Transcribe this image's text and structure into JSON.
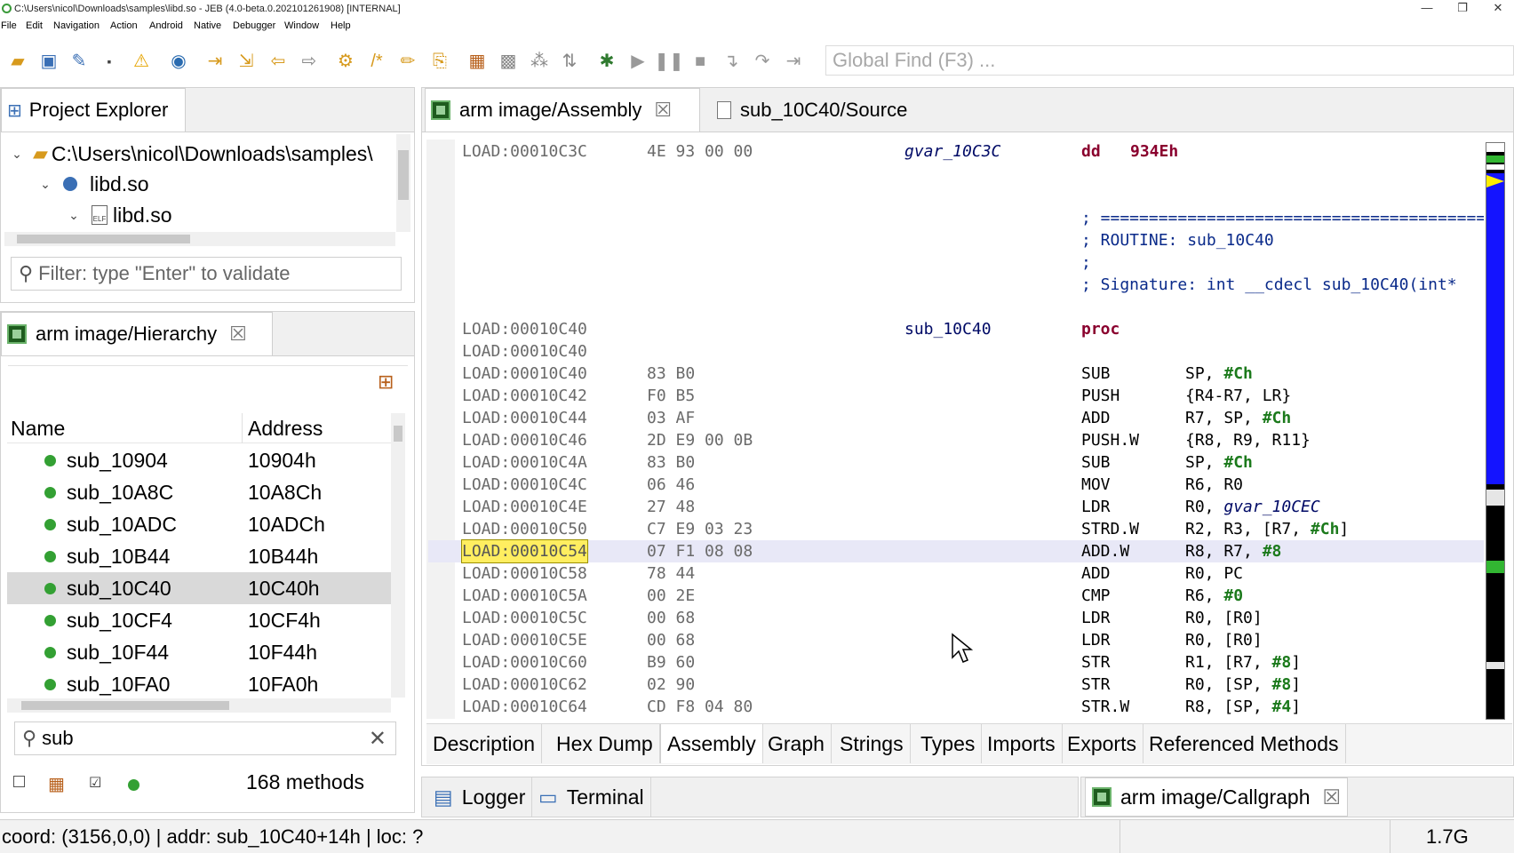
{
  "window": {
    "title": "C:\\Users\\nicol\\Downloads\\samples\\libd.so - JEB (4.0-beta.0.202101261908) [INTERNAL]",
    "controls": [
      "—",
      "❐",
      "✕"
    ]
  },
  "menu": [
    "File",
    "Edit",
    "Navigation",
    "Action",
    "Android",
    "Native",
    "Debugger",
    "Window",
    "Help"
  ],
  "toolbar": {
    "global_find_placeholder": "Global Find (F3) ..."
  },
  "project_explorer": {
    "tab_label": "Project Explorer",
    "tree": [
      {
        "label": "C:\\Users\\nicol\\Downloads\\samples\\",
        "icon": "folder-icon"
      },
      {
        "label": "libd.so",
        "icon": "artifact-icon"
      },
      {
        "label": "libd.so",
        "icon": "elf-file-icon"
      }
    ],
    "filter_placeholder": "Filter: type \"Enter\" to validate"
  },
  "hierarchy": {
    "tab_label": "arm image/Hierarchy",
    "columns": [
      "Name",
      "Address"
    ],
    "rows": [
      {
        "name": "sub_10904",
        "address": "10904h"
      },
      {
        "name": "sub_10A8C",
        "address": "10A8Ch"
      },
      {
        "name": "sub_10ADC",
        "address": "10ADCh"
      },
      {
        "name": "sub_10B44",
        "address": "10B44h"
      },
      {
        "name": "sub_10C40",
        "address": "10C40h",
        "selected": true
      },
      {
        "name": "sub_10CF4",
        "address": "10CF4h"
      },
      {
        "name": "sub_10F44",
        "address": "10F44h"
      },
      {
        "name": "sub_10FA0",
        "address": "10FA0h"
      }
    ],
    "search_value": "sub",
    "methods_count": "168 methods"
  },
  "editor": {
    "tabs": [
      {
        "label": "arm image/Assembly",
        "active": true
      },
      {
        "label": "sub_10C40/Source",
        "active": false
      }
    ],
    "lines": [
      {
        "addr": "LOAD:00010C3C",
        "bytes": "4E 93 00 00",
        "label": "gvar_10C3C",
        "label_italic": true,
        "mn": "dd",
        "kw": true,
        "ops": [
          {
            "t": "934Eh",
            "k": "kwval"
          }
        ]
      },
      {
        "blank": true
      },
      {
        "blank": true
      },
      {
        "comment": "; ======================================================"
      },
      {
        "comment": "; ROUTINE: sub_10C40"
      },
      {
        "comment": ";"
      },
      {
        "comment": "; Signature: int __cdecl sub_10C40(int*"
      },
      {
        "blank": true
      },
      {
        "addr": "LOAD:00010C40",
        "label": "sub_10C40",
        "mn": "proc",
        "kw": true
      },
      {
        "addr": "LOAD:00010C40"
      },
      {
        "addr": "LOAD:00010C40",
        "bytes": "83 B0",
        "mn": "SUB",
        "ops": [
          {
            "t": "SP, "
          },
          {
            "t": "#Ch",
            "k": "imm"
          }
        ]
      },
      {
        "addr": "LOAD:00010C42",
        "bytes": "F0 B5",
        "mn": "PUSH",
        "ops": [
          {
            "t": "{R4-R7, LR}"
          }
        ]
      },
      {
        "addr": "LOAD:00010C44",
        "bytes": "03 AF",
        "mn": "ADD",
        "ops": [
          {
            "t": "R7, SP, "
          },
          {
            "t": "#Ch",
            "k": "imm"
          }
        ]
      },
      {
        "addr": "LOAD:00010C46",
        "bytes": "2D E9 00 0B",
        "mn": "PUSH.W",
        "ops": [
          {
            "t": "{R8, R9, R11}"
          }
        ]
      },
      {
        "addr": "LOAD:00010C4A",
        "bytes": "83 B0",
        "mn": "SUB",
        "ops": [
          {
            "t": "SP, "
          },
          {
            "t": "#Ch",
            "k": "imm"
          }
        ]
      },
      {
        "addr": "LOAD:00010C4C",
        "bytes": "06 46",
        "mn": "MOV",
        "ops": [
          {
            "t": "R6, R0"
          }
        ]
      },
      {
        "addr": "LOAD:00010C4E",
        "bytes": "27 48",
        "mn": "LDR",
        "ops": [
          {
            "t": "R0, "
          },
          {
            "t": "gvar_10CEC",
            "k": "sym"
          }
        ]
      },
      {
        "addr": "LOAD:00010C50",
        "bytes": "C7 E9 03 23",
        "mn": "STRD.W",
        "ops": [
          {
            "t": "R2, R3, [R7, "
          },
          {
            "t": "#Ch",
            "k": "imm"
          },
          {
            "t": "]"
          }
        ]
      },
      {
        "addr": "LOAD:00010C54",
        "bytes": "07 F1 08 08",
        "mn": "ADD.W",
        "current": true,
        "ops": [
          {
            "t": "R8, R7, "
          },
          {
            "t": "#8",
            "k": "imm"
          }
        ]
      },
      {
        "addr": "LOAD:00010C58",
        "bytes": "78 44",
        "mn": "ADD",
        "ops": [
          {
            "t": "R0, PC"
          }
        ]
      },
      {
        "addr": "LOAD:00010C5A",
        "bytes": "00 2E",
        "mn": "CMP",
        "ops": [
          {
            "t": "R6, "
          },
          {
            "t": "#0",
            "k": "imm"
          }
        ]
      },
      {
        "addr": "LOAD:00010C5C",
        "bytes": "00 68",
        "mn": "LDR",
        "ops": [
          {
            "t": "R0, [R0]"
          }
        ]
      },
      {
        "addr": "LOAD:00010C5E",
        "bytes": "00 68",
        "mn": "LDR",
        "ops": [
          {
            "t": "R0, [R0]"
          }
        ]
      },
      {
        "addr": "LOAD:00010C60",
        "bytes": "B9 60",
        "mn": "STR",
        "ops": [
          {
            "t": "R1, [R7, "
          },
          {
            "t": "#8",
            "k": "imm"
          },
          {
            "t": "]"
          }
        ]
      },
      {
        "addr": "LOAD:00010C62",
        "bytes": "02 90",
        "mn": "STR",
        "ops": [
          {
            "t": "R0, [SP, "
          },
          {
            "t": "#8",
            "k": "imm"
          },
          {
            "t": "]"
          }
        ]
      },
      {
        "addr": "LOAD:00010C64",
        "bytes": "CD F8 04 80",
        "mn": "STR.W",
        "ops": [
          {
            "t": "R8, [SP, "
          },
          {
            "t": "#4",
            "k": "imm"
          },
          {
            "t": "]"
          }
        ]
      }
    ],
    "subtabs": [
      "Description",
      "Hex Dump",
      "Assembly",
      "Graph",
      "Strings",
      "Types",
      "Imports",
      "Exports",
      "Referenced Methods"
    ],
    "active_subtab": "Assembly"
  },
  "bottom_tabs": {
    "left": [
      "Logger",
      "Terminal"
    ],
    "right": "arm image/Callgraph"
  },
  "status": {
    "text": "coord: (3156,0,0) | addr: sub_10C40+14h | loc: ?",
    "memory": "1.7G"
  },
  "colors": {
    "accent_green": "#33a033",
    "keyword": "#8a002e",
    "immediate": "#1c7a1c",
    "current_line_addr": "#ffee60",
    "ruler_blue": "#1414ff"
  }
}
